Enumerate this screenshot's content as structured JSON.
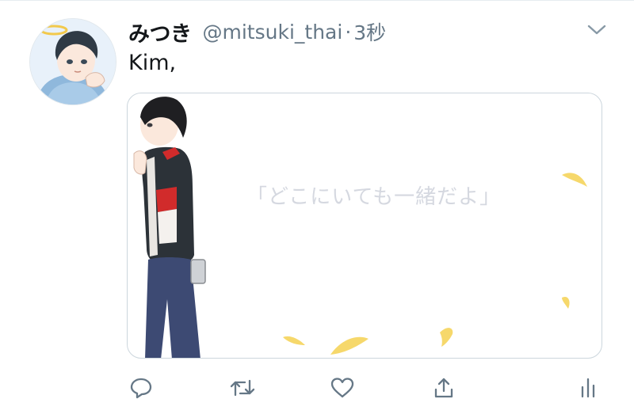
{
  "tweet": {
    "display_name": "みつき",
    "handle": "@mitsuki_thai",
    "separator": "·",
    "time": "3秒",
    "text": "Kim,",
    "media": {
      "overlay_text": "「どこにいても一緒だよ」"
    }
  },
  "icons": {
    "reply": "reply-icon",
    "retweet": "retweet-icon",
    "like": "like-icon",
    "share": "share-icon",
    "analytics": "analytics-icon",
    "more": "chevron-down-icon"
  },
  "colors": {
    "text": "#14171a",
    "secondary": "#657786",
    "border": "#ccd6dd"
  }
}
